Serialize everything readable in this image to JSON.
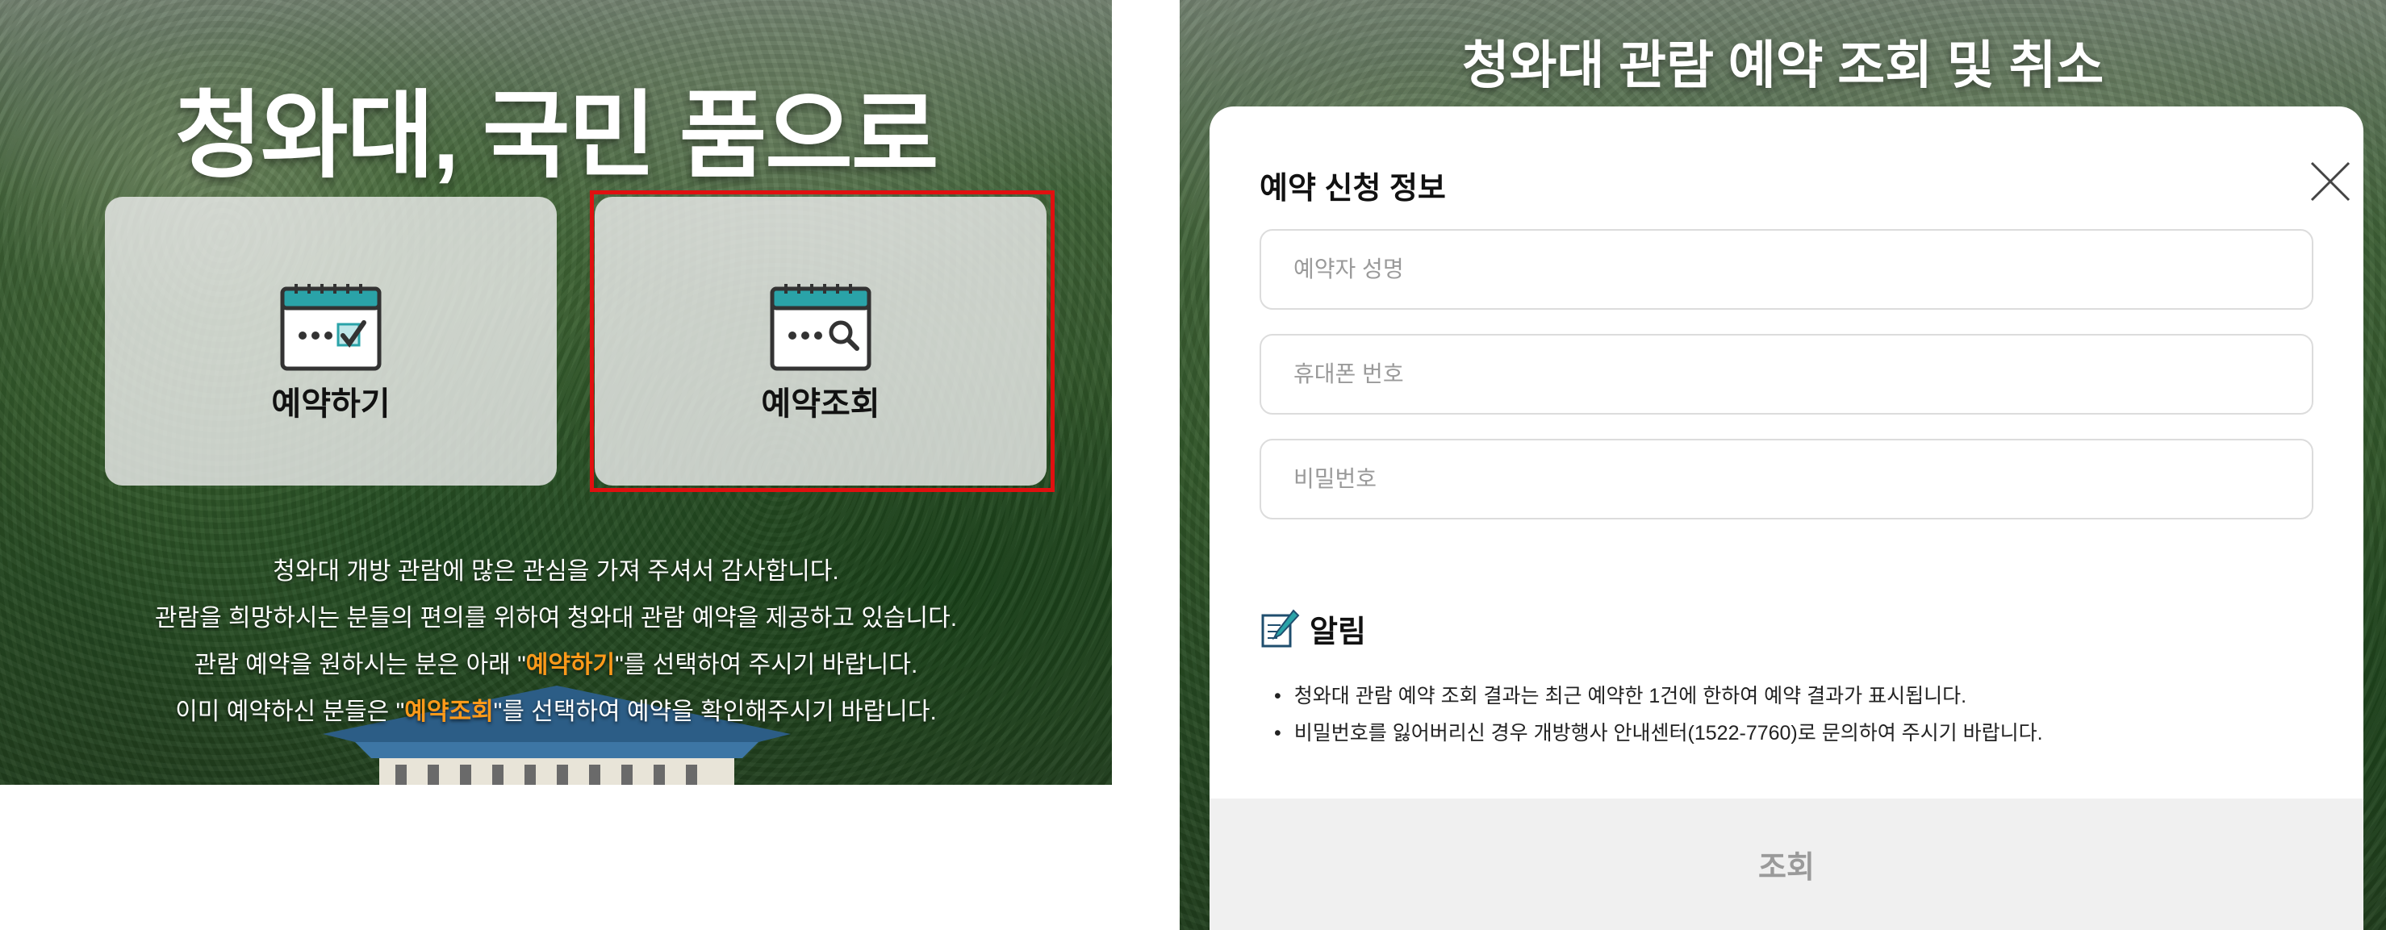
{
  "left": {
    "title": "청와대, 국민 품으로",
    "cards": {
      "reserve": {
        "label": "예약하기",
        "icon": "calendar-check-icon"
      },
      "inquiry": {
        "label": "예약조회",
        "icon": "calendar-search-icon"
      }
    },
    "notice": {
      "line1": "청와대 개방 관람에 많은 관심을 가져 주셔서 감사합니다.",
      "line2": "관람을 희망하시는 분들의 편의를 위하여 청와대 관람 예약을 제공하고 있습니다.",
      "line3_pre": "관람 예약을 원하시는 분은 아래 \"",
      "line3_hl": "예약하기",
      "line3_post": "\"를 선택하여 주시기 바랍니다.",
      "line4_pre": "이미 예약하신 분들은 \"",
      "line4_hl": "예약조회",
      "line4_post": "\"를 선택하여 예약을 확인해주시기 바랍니다."
    }
  },
  "right": {
    "title": "청와대 관람 예약 조회 및 취소",
    "modal": {
      "heading": "예약 신청 정보",
      "fields": {
        "name_placeholder": "예약자 성명",
        "phone_placeholder": "휴대폰 번호",
        "password_placeholder": "비밀번호"
      },
      "alert": {
        "title": "알림",
        "items": [
          "청와대 관람 예약 조회 결과는 최근 예약한 1건에 한하여 예약 결과가 표시됩니다.",
          "비밀번호를 잃어버리신 경우 개방행사 안내센터(1522-7760)로 문의하여 주시기 바랍니다."
        ]
      },
      "submit_label": "조회"
    }
  },
  "colors": {
    "highlight_text": "#ff9a1a",
    "selection_border": "#e01010",
    "calendar_teal": "#2aa3a8"
  }
}
